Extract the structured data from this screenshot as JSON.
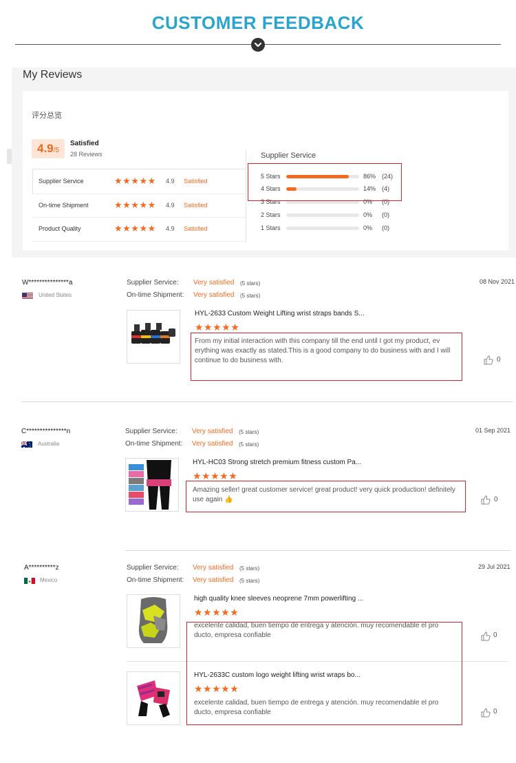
{
  "header": {
    "title": "CUSTOMER FEEDBACK"
  },
  "reviews_panel": {
    "title": "My Reviews",
    "summary_label": "评分总览",
    "score": "4.9",
    "score_suffix": "/5",
    "status": "Satisfied",
    "review_count": "28 Reviews",
    "criteria": [
      {
        "label": "Supplier Service",
        "score": "4.9",
        "status": "Satisfied"
      },
      {
        "label": "On-time Shipment",
        "score": "4.9",
        "status": "Satisfied"
      },
      {
        "label": "Product Quality",
        "score": "4.9",
        "status": "Satisfied"
      }
    ],
    "breakdown_title": "Supplier Service",
    "breakdown": [
      {
        "label": "5 Stars",
        "fraction": 0.86,
        "pct": "86%",
        "count": "(24)"
      },
      {
        "label": "4 Stars",
        "fraction": 0.14,
        "pct": "14%",
        "count": "(4)"
      },
      {
        "label": "3 Stars",
        "fraction": 0,
        "pct": "0%",
        "count": "(0)"
      },
      {
        "label": "2 Stars",
        "fraction": 0,
        "pct": "0%",
        "count": "(0)"
      },
      {
        "label": "1 Stars",
        "fraction": 0,
        "pct": "0%",
        "count": "(0)"
      }
    ]
  },
  "stars_glyph": "★★★★★",
  "thumbs_icon": "thumbs-up-icon",
  "accent_color": "#f36b21",
  "highlight_color": "#c7262c",
  "reviews": [
    {
      "name": "W***************a",
      "country": "United States",
      "supplier_label": "Supplier Service:",
      "supplier_value": "Very satisfied",
      "supplier_stars": "(5 stars)",
      "shipment_label": "On-time Shipment:",
      "shipment_value": "Very satisfied",
      "shipment_stars": "(5 stars)",
      "date": "08 Nov 2021",
      "items": [
        {
          "product": "HYL-2633 Custom Weight Lifting wrist straps bands S...",
          "text": "From my initial interaction with this company till the end until I got my product, ev erything was exactly as stated.This is a good company to do business with and I will continue to do business with.",
          "likes": "0"
        }
      ]
    },
    {
      "name": "C***************n",
      "country": "Australia",
      "supplier_label": "Supplier Service:",
      "supplier_value": "Very satisfied",
      "supplier_stars": "(5 stars)",
      "shipment_label": "On-time Shipment:",
      "shipment_value": "Very satisfied",
      "shipment_stars": "(5 stars)",
      "date": "01 Sep 2021",
      "items": [
        {
          "product": "HYL-HC03 Strong stretch premium fitness custom Pa...",
          "text": "Amazing seller! great customer service! great product! very quick production! definitely use again 👍",
          "likes": "0"
        }
      ]
    },
    {
      "name": "A**********z",
      "country": "Mexico",
      "supplier_label": "Supplier Service:",
      "supplier_value": "Very satisfied",
      "supplier_stars": "(5 stars)",
      "shipment_label": "On-time Shipment:",
      "shipment_value": "Very satisfied",
      "shipment_stars": "(5 stars)",
      "date": "29 Jul 2021",
      "items": [
        {
          "product": "high quality knee sleeves neoprene 7mm powerlifting ...",
          "text": "excelente calidad,  buen tiempo de entrega y atención.  muy recomendable el pro ducto, empresa confiable",
          "likes": "0"
        },
        {
          "product": "HYL-2633C custom logo weight lifting wrist wraps bo...",
          "text": "excelente calidad,  buen tiempo de entrega y atención.  muy recomendable el pro ducto, empresa confiable",
          "likes": "0"
        }
      ]
    }
  ]
}
